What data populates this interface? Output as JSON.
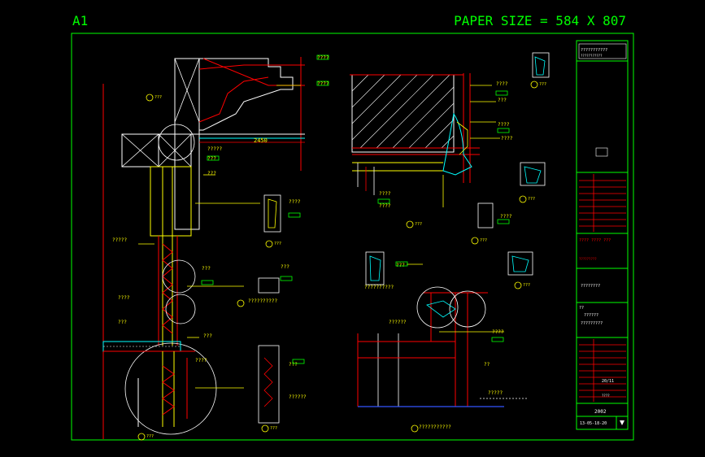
{
  "sheet": {
    "size_label": "A1",
    "paper_size": "PAPER SIZE = 584 X 807"
  },
  "drawing": {
    "dim_top": "2450",
    "dim_small": "???",
    "callouts": [
      "????",
      "????",
      "???",
      "???",
      "????",
      "?????",
      "???",
      "???",
      "????",
      "??????????",
      "???",
      "?????",
      "????",
      "???",
      "??????",
      "????"
    ],
    "section_markers": [
      "???",
      "???",
      "???",
      "???",
      "???",
      "???",
      "???",
      "???",
      "???"
    ],
    "notes": {
      "left_long": "?????????",
      "mid_long": "???????????",
      "right_long": "??????????",
      "bottom_mid": "???????????",
      "qq": "??"
    }
  },
  "title_block": {
    "project_header": "???????????",
    "company": "???????????",
    "company_red": "???? ???? ???",
    "sub_red": "?????????",
    "drawing_title": "????????",
    "q_label": "??",
    "drawing_name_1": "??????",
    "drawing_name_2": "?????????",
    "scale": "20/11",
    "sheet_no": "????",
    "number_label": "2002",
    "drawing_code": "13-05-18-20"
  },
  "colors": {
    "frame": "#00ff00",
    "lines_yellow": "#ffff00",
    "lines_red": "#ff0000",
    "lines_cyan": "#00ffff",
    "lines_white": "#ffffff",
    "lines_blue": "#3355ff"
  }
}
